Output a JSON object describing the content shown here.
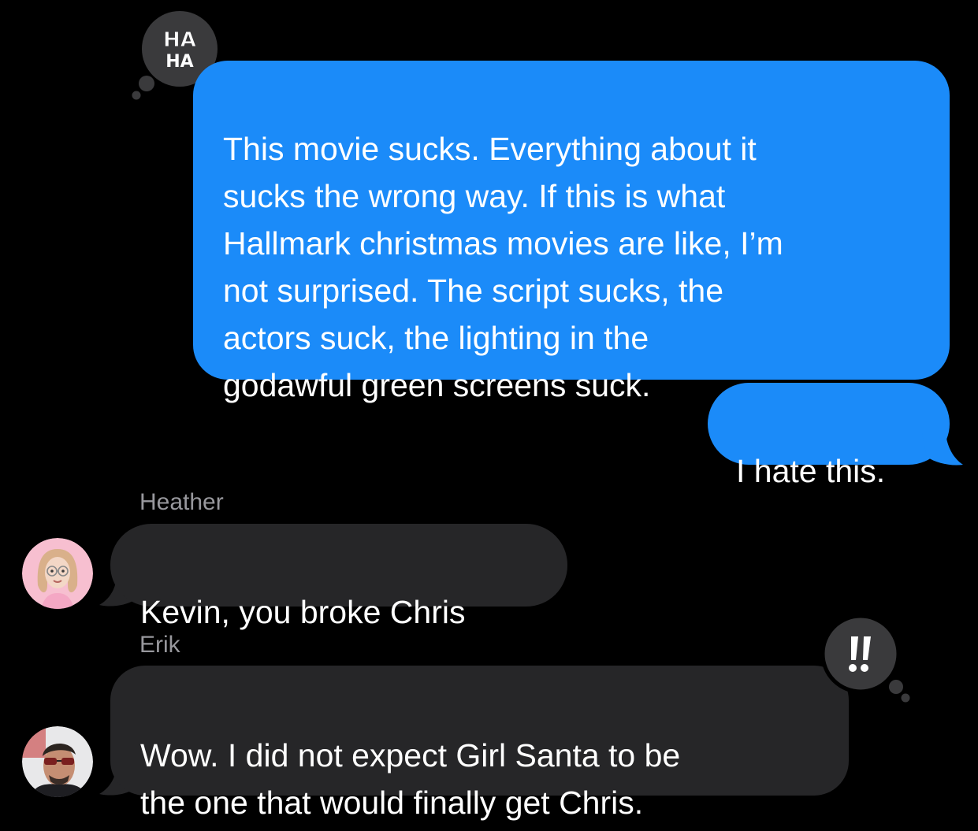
{
  "conversation": {
    "messages": [
      {
        "sender": "me",
        "text": "This movie sucks. Everything about it\nsucks the wrong way. If this is what\nHallmark christmas movies are like, I’m\nnot surprised. The script sucks, the\nactors suck, the lighting in the\ngodawful green screens suck.",
        "reaction": "HA HA"
      },
      {
        "sender": "me",
        "text": "I hate this."
      },
      {
        "sender_name": "Heather",
        "text": "Kevin, you broke Chris"
      },
      {
        "sender_name": "Erik",
        "text": "Wow. I did not expect Girl Santa to be\nthe one that would finally get Chris.",
        "reaction": "!!"
      }
    ]
  },
  "colors": {
    "background": "#000000",
    "outgoing_bubble": "#1b8bf9",
    "incoming_bubble": "#262628",
    "reaction_bubble": "#3a3a3c",
    "sender_name": "#98989d"
  },
  "icons": {
    "haha_reaction": "haha-reaction-icon",
    "exclamation_reaction": "exclamation-reaction-icon",
    "heather_avatar": "memoji-avatar",
    "erik_avatar": "photo-avatar"
  }
}
